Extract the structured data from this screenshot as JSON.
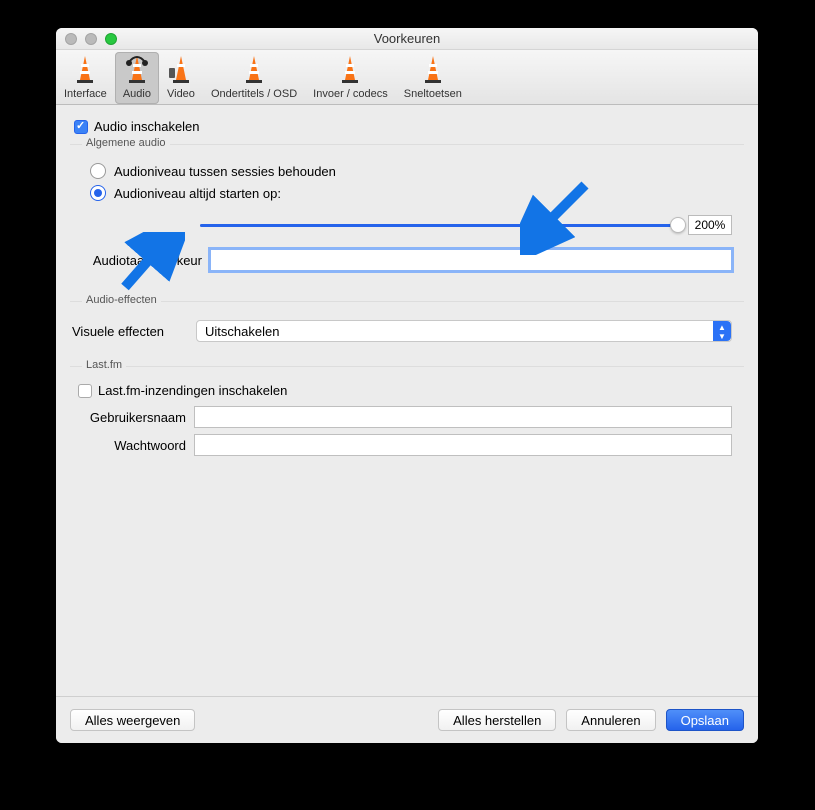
{
  "window": {
    "title": "Voorkeuren"
  },
  "toolbar": {
    "items": [
      {
        "label": "Interface"
      },
      {
        "label": "Audio",
        "selected": true
      },
      {
        "label": "Video"
      },
      {
        "label": "Ondertitels / OSD"
      },
      {
        "label": "Invoer / codecs"
      },
      {
        "label": "Sneltoetsen"
      }
    ]
  },
  "audio": {
    "enable_label": "Audio inschakelen",
    "general_group": "Algemene audio",
    "radio_keep": "Audioniveau tussen sessies behouden",
    "radio_start": "Audioniveau altijd starten op:",
    "volume_pct": "200%",
    "lang_pref_label": "Audiotaal-voorkeur",
    "lang_pref_value": ""
  },
  "effects": {
    "group": "Audio-effecten",
    "visual_label": "Visuele effecten",
    "visual_value": "Uitschakelen"
  },
  "lastfm": {
    "group": "Last.fm",
    "enable": "Last.fm-inzendingen inschakelen",
    "user_label": "Gebruikersnaam",
    "pass_label": "Wachtwoord"
  },
  "footer": {
    "show_all": "Alles weergeven",
    "reset": "Alles herstellen",
    "cancel": "Annuleren",
    "save": "Opslaan"
  }
}
